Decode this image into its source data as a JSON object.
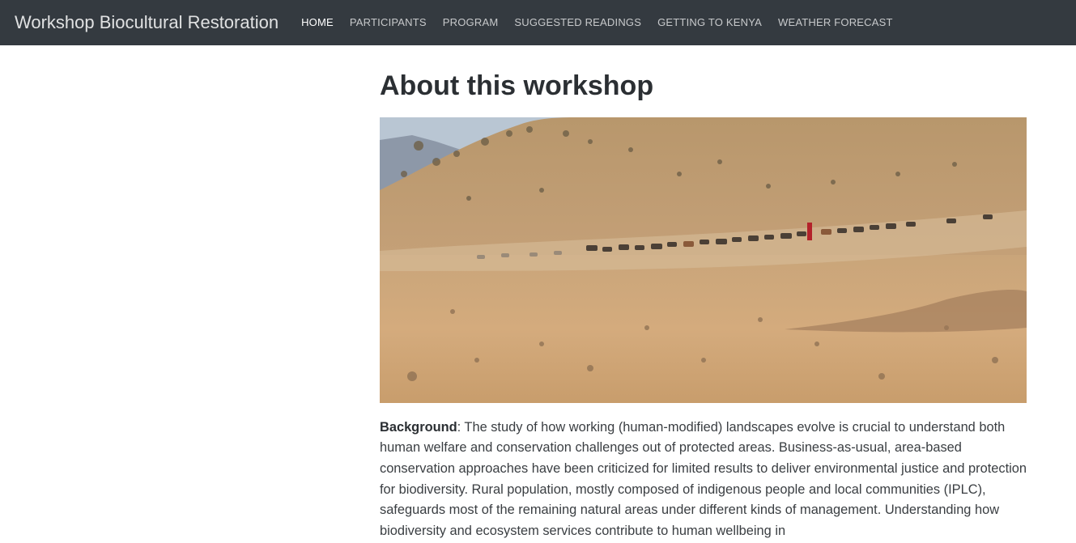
{
  "nav": {
    "brand": "Workshop Biocultural Restoration",
    "items": [
      {
        "label": "HOME",
        "active": true
      },
      {
        "label": "PARTICIPANTS",
        "active": false
      },
      {
        "label": "PROGRAM",
        "active": false
      },
      {
        "label": "SUGGESTED READINGS",
        "active": false
      },
      {
        "label": "GETTING TO KENYA",
        "active": false
      },
      {
        "label": "WEATHER FORECAST",
        "active": false
      }
    ]
  },
  "main": {
    "title": "About this workshop",
    "background_label": "Background",
    "background_text": ": The study of how working (human-modified) landscapes evolve is crucial to understand both human welfare and conservation challenges out of protected areas. Business-as-usual, area-based conservation approaches have been criticized for limited results to deliver environmental justice and protection for biodiversity. Rural population, mostly composed of indigenous people and local communities (IPLC), safeguards most of the remaining natural areas under different kinds of management. Understanding how biodiversity and ecosystem services contribute to human wellbeing in"
  },
  "colors": {
    "navbar_bg": "#343a40",
    "heading": "#2b2f33",
    "text": "#3a3e42"
  }
}
